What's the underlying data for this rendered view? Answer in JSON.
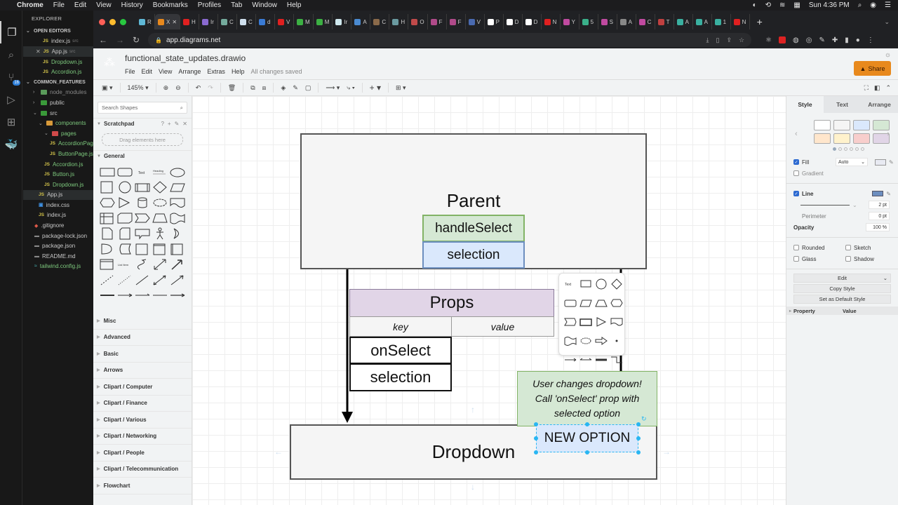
{
  "os_menubar": {
    "app": "Chrome",
    "items": [
      "File",
      "Edit",
      "View",
      "History",
      "Bookmarks",
      "Profiles",
      "Tab",
      "Window",
      "Help"
    ],
    "clock": "Sun 4:36 PM"
  },
  "vscode": {
    "explorer_title": "EXPLORER",
    "open_editors_title": "OPEN EDITORS",
    "open_editors": [
      {
        "name": "index.js",
        "dir": "src"
      },
      {
        "name": "App.js",
        "dir": "src"
      },
      {
        "name": "Dropdown.js",
        "dir": ""
      },
      {
        "name": "Accordion.js",
        "dir": ""
      }
    ],
    "project_title": "COMMON_FEATURES",
    "source_control_badge": "16",
    "tree": [
      {
        "name": "node_modules",
        "kind": "folder"
      },
      {
        "name": "public",
        "kind": "folder"
      },
      {
        "name": "src",
        "kind": "folder"
      },
      {
        "name": "components",
        "kind": "folder"
      },
      {
        "name": "pages",
        "kind": "folder"
      },
      {
        "name": "AccordionPage.js",
        "kind": "js"
      },
      {
        "name": "ButtonPage.js",
        "kind": "js"
      },
      {
        "name": "Accordion.js",
        "kind": "js"
      },
      {
        "name": "Button.js",
        "kind": "js"
      },
      {
        "name": "Dropdown.js",
        "kind": "js"
      },
      {
        "name": "App.js",
        "kind": "js"
      },
      {
        "name": "index.css",
        "kind": "css"
      },
      {
        "name": "index.js",
        "kind": "js"
      },
      {
        "name": ".gitignore",
        "kind": "git"
      },
      {
        "name": "package-lock.json",
        "kind": "json"
      },
      {
        "name": "package.json",
        "kind": "json"
      },
      {
        "name": "README.md",
        "kind": "md"
      },
      {
        "name": "tailwind.config.js",
        "kind": "config"
      }
    ]
  },
  "browser": {
    "tabs": [
      {
        "label": "R",
        "color": "#5fb8d6"
      },
      {
        "label": "X",
        "color": "#e8891d",
        "active": true
      },
      {
        "label": "H",
        "color": "#e02020"
      },
      {
        "label": "Ir",
        "color": "#8a6ad0"
      },
      {
        "label": "C",
        "color": "#74aa9c"
      },
      {
        "label": "C",
        "color": "#cfe0ee"
      },
      {
        "label": "d",
        "color": "#3a7bd5"
      },
      {
        "label": "V",
        "color": "#e02020"
      },
      {
        "label": "M",
        "color": "#3cb043"
      },
      {
        "label": "M",
        "color": "#3cb043"
      },
      {
        "label": "Ir",
        "color": "#cfe8ee"
      },
      {
        "label": "A",
        "color": "#4a8ad0"
      },
      {
        "label": "C",
        "color": "#8a6a4a"
      },
      {
        "label": "H",
        "color": "#6a9aa0"
      },
      {
        "label": "O",
        "color": "#c04a4a"
      },
      {
        "label": "F",
        "color": "#b04a8a"
      },
      {
        "label": "F",
        "color": "#b04a8a"
      },
      {
        "label": "V",
        "color": "#4a6ab0"
      },
      {
        "label": "P",
        "color": "#ffffff"
      },
      {
        "label": "D",
        "color": "#ffffff"
      },
      {
        "label": "D",
        "color": "#ffffff"
      },
      {
        "label": "N",
        "color": "#e02020"
      },
      {
        "label": "Y",
        "color": "#c04aa0"
      },
      {
        "label": "5",
        "color": "#3ab08a"
      },
      {
        "label": "S",
        "color": "#c04aa0"
      },
      {
        "label": "A",
        "color": "#888888"
      },
      {
        "label": "C",
        "color": "#c04aa0"
      },
      {
        "label": "T",
        "color": "#c04040"
      },
      {
        "label": "A",
        "color": "#3ab0a0"
      },
      {
        "label": "A",
        "color": "#3ab0a0"
      },
      {
        "label": "1",
        "color": "#3ab0a0"
      },
      {
        "label": "N",
        "color": "#e02020"
      }
    ],
    "url": "app.diagrams.net"
  },
  "drawio": {
    "file_title": "functional_state_updates.drawio",
    "menu": [
      "File",
      "Edit",
      "View",
      "Arrange",
      "Extras",
      "Help"
    ],
    "save_status": "All changes saved",
    "share_label": "Share",
    "zoom": "145%",
    "left_panel": {
      "search_placeholder": "Search Shapes",
      "scratchpad": "Scratchpad",
      "scratchpad_tools": [
        "?",
        "+",
        "✎",
        "✕"
      ],
      "drag_hint": "Drag elements here",
      "general": "General",
      "categories": [
        "Misc",
        "Advanced",
        "Basic",
        "Arrows",
        "Clipart / Computer",
        "Clipart / Finance",
        "Clipart / Various",
        "Clipart / Networking",
        "Clipart / People",
        "Clipart / Telecommunication",
        "Flowchart"
      ]
    },
    "diagram": {
      "parent": "Parent",
      "handle_select": "handleSelect",
      "selection_state": "selection",
      "props_title": "Props",
      "props_key_header": "key",
      "props_value_header": "value",
      "props_keys": [
        "onSelect",
        "selection"
      ],
      "note": "User changes dropdown! Call 'onSelect' prop with selected option",
      "dropdown": "Dropdown",
      "new_option": "NEW OPTION",
      "colors": {
        "container_fill": "#f5f5f5",
        "green_fill": "#d5e8d4",
        "green_stroke": "#82b366",
        "blue_fill": "#dae8fc",
        "blue_stroke": "#6c8ebf",
        "purple_fill": "#e1d5e7",
        "selection_handle": "#29b6f2"
      }
    },
    "right_panel": {
      "tabs": [
        "Style",
        "Text",
        "Arrange"
      ],
      "swatches": [
        "#ffffff",
        "#f5f5f5",
        "#dae8fc",
        "#d5e8d4",
        "#ffe6cc",
        "#fff2cc",
        "#f8cecc",
        "#e1d5e7"
      ],
      "fill_label": "Fill",
      "fill_checked": true,
      "fill_mode": "Auto",
      "gradient_label": "Gradient",
      "gradient_checked": false,
      "line_label": "Line",
      "line_checked": true,
      "line_color": "#6c8ebf",
      "line_width": "2 pt",
      "perimeter_label": "Perimeter",
      "perimeter_value": "0 pt",
      "opacity_label": "Opacity",
      "opacity_value": "100 %",
      "rounded_label": "Rounded",
      "sketch_label": "Sketch",
      "glass_label": "Glass",
      "shadow_label": "Shadow",
      "edit_label": "Edit",
      "copy_style_label": "Copy Style",
      "default_style_label": "Set as Default Style",
      "property_header": "Property",
      "value_header": "Value"
    }
  }
}
